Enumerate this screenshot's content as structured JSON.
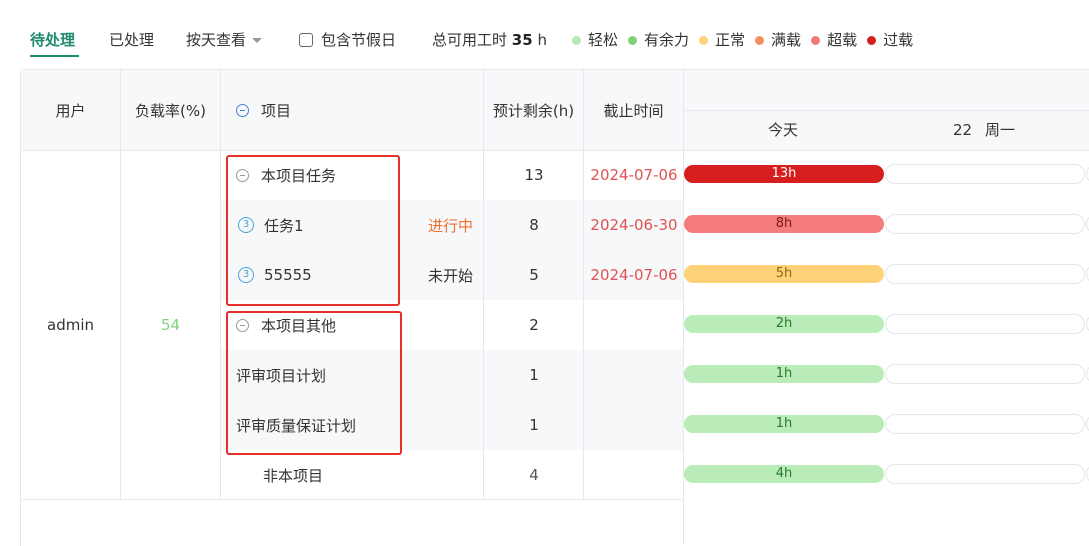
{
  "tabs": {
    "pending": "待处理",
    "done": "已处理"
  },
  "view_select": {
    "value": "按天查看"
  },
  "holiday_checkbox": {
    "label": "包含节假日",
    "checked": false
  },
  "total": {
    "prefix": "总可用工时",
    "value": "35",
    "unit": "h"
  },
  "legend": [
    {
      "label": "轻松",
      "color": "#b7e8b5"
    },
    {
      "label": "有余力",
      "color": "#7fd27a"
    },
    {
      "label": "正常",
      "color": "#ffd27a"
    },
    {
      "label": "满载",
      "color": "#f3915c"
    },
    {
      "label": "超载",
      "color": "#f07a7a"
    },
    {
      "label": "过载",
      "color": "#d71e1e"
    }
  ],
  "columns": {
    "user": "用户",
    "load": "负载率(%)",
    "project": "项目",
    "remaining": "预计剩余(h)",
    "deadline": "截止时间"
  },
  "gantt": {
    "today": "今天",
    "next_day": "22",
    "next_weekday": "周一"
  },
  "user": {
    "name": "admin",
    "load": "54"
  },
  "rows": [
    {
      "name": "本项目任务",
      "status": "",
      "remaining": "13",
      "deadline": "2024-07-06",
      "bar": "13h",
      "bar_color": "#d71e1e",
      "bar_text_color": "#ffffff"
    },
    {
      "name": "任务1",
      "badge": "3",
      "status": "进行中",
      "remaining": "8",
      "deadline": "2024-06-30",
      "bar": "8h",
      "bar_color": "#f47c7c",
      "bar_text_color": "#7a1a1a"
    },
    {
      "name": "55555",
      "badge": "3",
      "status": "未开始",
      "remaining": "5",
      "deadline": "2024-07-06",
      "bar": "5h",
      "bar_color": "#ffd27a",
      "bar_text_color": "#8a6a20"
    },
    {
      "name": "本项目其他",
      "status": "",
      "remaining": "2",
      "deadline": "",
      "bar": "2h",
      "bar_color": "#b9ecb9",
      "bar_text_color": "#2a7a2a"
    },
    {
      "name": "评审项目计划",
      "status": "",
      "remaining": "1",
      "deadline": "",
      "bar": "1h",
      "bar_color": "#b9ecb9",
      "bar_text_color": "#2a7a2a"
    },
    {
      "name": "评审质量保证计划",
      "status": "",
      "remaining": "1",
      "deadline": "",
      "bar": "1h",
      "bar_color": "#b9ecb9",
      "bar_text_color": "#2a7a2a"
    },
    {
      "name": "非本项目",
      "status": "",
      "remaining": "4",
      "deadline": "",
      "bar": "4h",
      "bar_color": "#b9ecb9",
      "bar_text_color": "#2a7a2a"
    }
  ]
}
